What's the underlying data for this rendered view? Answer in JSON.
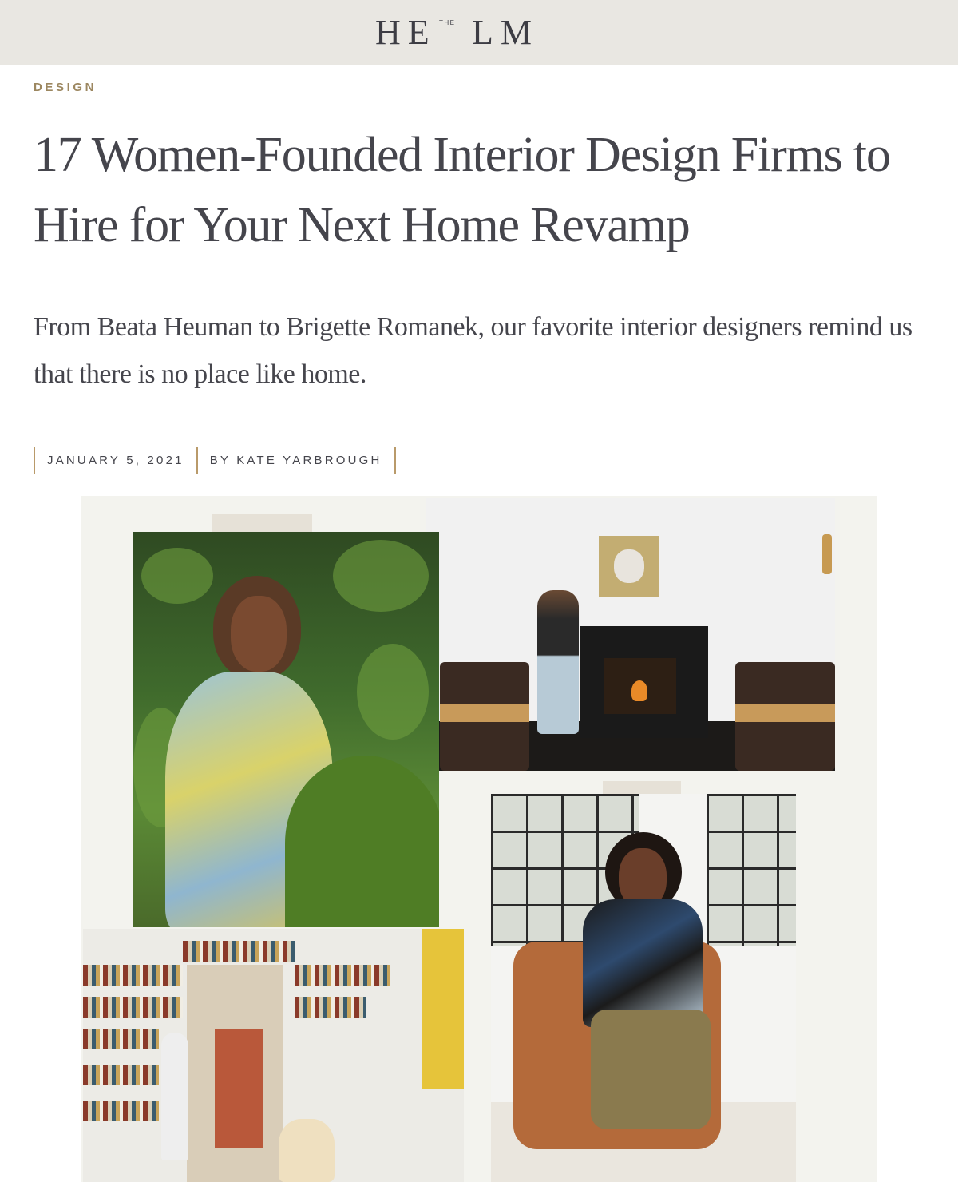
{
  "header": {
    "logo_left": "HE",
    "logo_small": "THE",
    "logo_right": "LM"
  },
  "article": {
    "category": "DESIGN",
    "title": "17 Women-Founded Interior Design Firms to Hire for Your Next Home Revamp",
    "dek": "From Beata Heuman to Brigette Romanek, our favorite interior designers remind us that there is no place like home.",
    "date": "JANUARY 5, 2021",
    "byline": "BY KATE YARBROUGH"
  },
  "colors": {
    "topbar": "#e9e7e2",
    "category_gold": "#9c8760",
    "divider_gold": "#b99a6a",
    "text": "#45454c"
  }
}
